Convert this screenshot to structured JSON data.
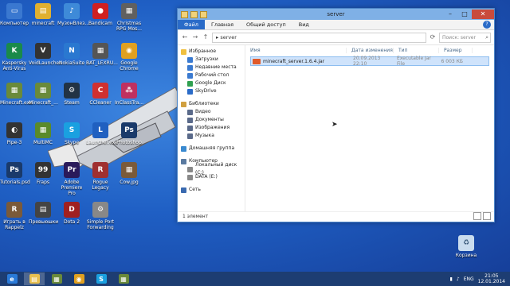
{
  "desktop": {
    "icons": [
      {
        "label": "Компьютер",
        "color": "#3a78d0",
        "glyph": "▭"
      },
      {
        "label": "minecraft",
        "color": "#e0b030",
        "glyph": "▤"
      },
      {
        "label": "МузонВлез...",
        "color": "#3e8ad8",
        "glyph": "♪"
      },
      {
        "label": "Bandicam",
        "color": "#d02020",
        "glyph": "●"
      },
      {
        "label": "Christmas RPG Mos...",
        "color": "#606060",
        "glyph": "▦"
      },
      {
        "label": "Kaspersky Anti-Virus",
        "color": "#1a8a4a",
        "glyph": "K"
      },
      {
        "label": "VoidLauncher",
        "color": "#333",
        "glyph": "V"
      },
      {
        "label": "NokiaSuite",
        "color": "#2a78d0",
        "glyph": "N"
      },
      {
        "label": "BAT_LEXRU...",
        "color": "#555",
        "glyph": "▦"
      },
      {
        "label": "Google Chrome",
        "color": "#e0a020",
        "glyph": "◉"
      },
      {
        "label": "Minecraft.exe",
        "color": "#6a8a3a",
        "glyph": "▦"
      },
      {
        "label": "Minecraft_...",
        "color": "#6a8a3a",
        "glyph": "▦"
      },
      {
        "label": "Steam",
        "color": "#223344",
        "glyph": "⚙"
      },
      {
        "label": "CCleaner",
        "color": "#d03030",
        "glyph": "C"
      },
      {
        "label": "InClassTra...",
        "color": "#c03060",
        "glyph": "⁂"
      },
      {
        "label": "Pipe-3",
        "color": "#333",
        "glyph": "◐"
      },
      {
        "label": "MultiMC",
        "color": "#5a8a2a",
        "glyph": "▦"
      },
      {
        "label": "Skype",
        "color": "#1aa0e0",
        "glyph": "S"
      },
      {
        "label": "Launcher.exe",
        "color": "#2060c0",
        "glyph": "L"
      },
      {
        "label": "Photoshop",
        "color": "#1a3a6a",
        "glyph": "Ps"
      },
      {
        "label": "Tutorials.psd",
        "color": "#1a3a6a",
        "glyph": "Ps"
      },
      {
        "label": "Fraps",
        "color": "#333",
        "glyph": "99"
      },
      {
        "label": "Adobe Premiere Pro",
        "color": "#2a1a5a",
        "glyph": "Pr"
      },
      {
        "label": "Rogue Legacy",
        "color": "#a03030",
        "glyph": "R"
      },
      {
        "label": "Cow.jpg",
        "color": "#7a5a3a",
        "glyph": "▦"
      },
      {
        "label": "Играть в Rappelz",
        "color": "#7a5a3a",
        "glyph": "R"
      },
      {
        "label": "Превьюшки",
        "color": "#444",
        "glyph": "▤"
      },
      {
        "label": "Dota 2",
        "color": "#a02020",
        "glyph": "D"
      },
      {
        "label": "Simple Port Forwarding",
        "color": "#888",
        "glyph": "⚙"
      }
    ],
    "recycle_bin": "Корзина"
  },
  "explorer": {
    "title": "server",
    "ribbon": {
      "tabs": [
        "Файл",
        "Главная",
        "Общий доступ",
        "Вид"
      ],
      "help": "?"
    },
    "address": {
      "path": "server",
      "search_placeholder": "Поиск: server"
    },
    "nav": [
      {
        "label": "Избранное",
        "level": 1,
        "color": "#f0c040"
      },
      {
        "label": "Загрузки",
        "level": 2,
        "color": "#3a7ad0"
      },
      {
        "label": "Недавние места",
        "level": 2,
        "color": "#3a7ad0"
      },
      {
        "label": "Рабочий стол",
        "level": 2,
        "color": "#3a7ad0"
      },
      {
        "label": "Google Диск",
        "level": 2,
        "color": "#30a050"
      },
      {
        "label": "SkyDrive",
        "level": 2,
        "color": "#2a6bc8"
      },
      {
        "gap": true
      },
      {
        "label": "Библиотеки",
        "level": 1,
        "color": "#d0a040"
      },
      {
        "label": "Видео",
        "level": 2,
        "color": "#5a6a8a"
      },
      {
        "label": "Документы",
        "level": 2,
        "color": "#5a6a8a"
      },
      {
        "label": "Изображения",
        "level": 2,
        "color": "#5a6a8a"
      },
      {
        "label": "Музыка",
        "level": 2,
        "color": "#5a6a8a"
      },
      {
        "gap": true
      },
      {
        "label": "Домашняя группа",
        "level": 1,
        "color": "#3a8ad0"
      },
      {
        "gap": true
      },
      {
        "label": "Компьютер",
        "level": 1,
        "color": "#5a7aa0"
      },
      {
        "label": "Локальный диск (C:)",
        "level": 2,
        "color": "#888"
      },
      {
        "label": "DATA (E:)",
        "level": 2,
        "color": "#888"
      },
      {
        "gap": true
      },
      {
        "label": "Сеть",
        "level": 1,
        "color": "#3a6ab0"
      }
    ],
    "columns": [
      "Имя",
      "Дата изменения",
      "Тип",
      "Размер"
    ],
    "files": [
      {
        "name": "minecraft_server.1.6.4.jar",
        "date": "20.09.2013 22:10",
        "type": "Executable Jar File",
        "size": "6 003 КБ"
      }
    ],
    "status": "1 элемент"
  },
  "taskbar": {
    "items": [
      {
        "color": "#2a7ad8",
        "glyph": "e",
        "active": false
      },
      {
        "color": "#e8c050",
        "glyph": "▤",
        "active": true
      },
      {
        "color": "#6a8a3a",
        "glyph": "▦",
        "active": false
      },
      {
        "color": "#e0a020",
        "glyph": "◉",
        "active": false
      },
      {
        "color": "#1aa0e0",
        "glyph": "S",
        "active": false
      },
      {
        "color": "#6a8a3a",
        "glyph": "▦",
        "active": false
      }
    ],
    "lang": "ENG",
    "time": "21:05",
    "date": "12.01.2014"
  }
}
